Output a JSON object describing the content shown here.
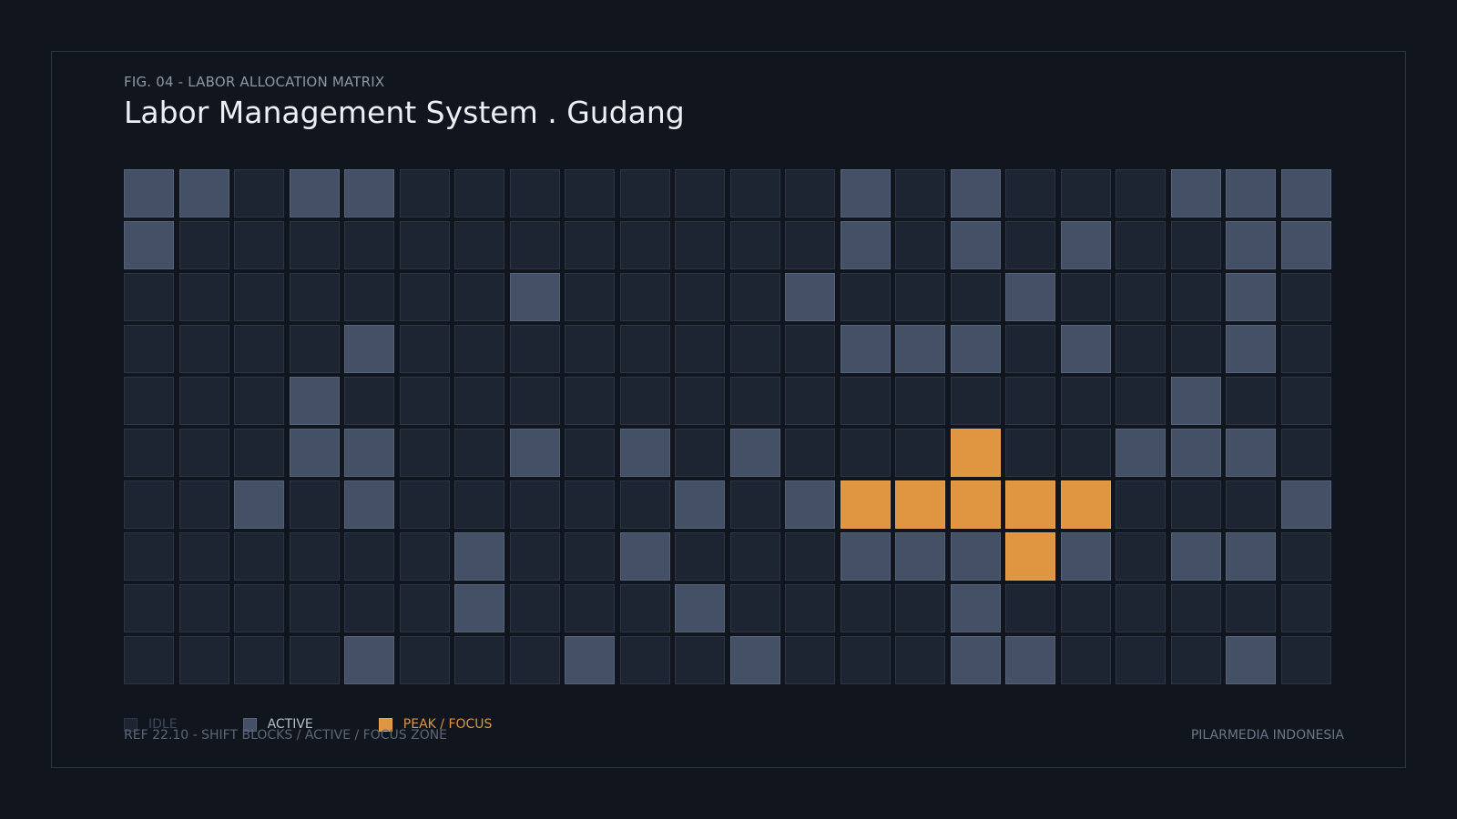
{
  "header": {
    "fig_label": "FIG. 04 - LABOR ALLOCATION MATRIX",
    "title": "Labor Management System . Gudang"
  },
  "legend": {
    "idle": "IDLE",
    "active": "ACTIVE",
    "peak": "PEAK / FOCUS"
  },
  "footer": {
    "ref": "REF 22.10 - SHIFT BLOCKS / ACTIVE / FOCUS ZONE",
    "brand": "PILARMEDIA INDONESIA"
  },
  "colors": {
    "background": "#10151e",
    "idle": "#1e2532",
    "active": "#435066",
    "peak": "#e09540"
  },
  "chart_data": {
    "type": "heatmap",
    "columns": 22,
    "rows": 10,
    "levels": [
      "idle",
      "active",
      "peak"
    ],
    "values": [
      [
        1,
        1,
        0,
        1,
        1,
        0,
        0,
        0,
        0,
        0,
        0,
        0,
        0,
        1,
        0,
        1,
        0,
        0,
        0,
        1,
        1,
        1
      ],
      [
        1,
        0,
        0,
        0,
        0,
        0,
        0,
        0,
        0,
        0,
        0,
        0,
        0,
        1,
        0,
        1,
        0,
        1,
        0,
        0,
        1,
        1
      ],
      [
        0,
        0,
        0,
        0,
        0,
        0,
        0,
        1,
        0,
        0,
        0,
        0,
        1,
        0,
        0,
        0,
        1,
        0,
        0,
        0,
        1,
        0
      ],
      [
        0,
        0,
        0,
        0,
        1,
        0,
        0,
        0,
        0,
        0,
        0,
        0,
        0,
        1,
        1,
        1,
        0,
        1,
        0,
        0,
        1,
        0
      ],
      [
        0,
        0,
        0,
        1,
        0,
        0,
        0,
        0,
        0,
        0,
        0,
        0,
        0,
        0,
        0,
        0,
        0,
        0,
        0,
        1,
        0,
        0
      ],
      [
        0,
        0,
        0,
        1,
        1,
        0,
        0,
        1,
        0,
        1,
        0,
        1,
        0,
        0,
        0,
        2,
        0,
        0,
        1,
        1,
        1,
        0
      ],
      [
        0,
        0,
        1,
        0,
        1,
        0,
        0,
        0,
        0,
        0,
        1,
        0,
        1,
        2,
        2,
        2,
        2,
        2,
        0,
        0,
        0,
        1
      ],
      [
        0,
        0,
        0,
        0,
        0,
        0,
        1,
        0,
        0,
        1,
        0,
        0,
        0,
        1,
        1,
        1,
        2,
        1,
        0,
        1,
        1,
        0
      ],
      [
        0,
        0,
        0,
        0,
        0,
        0,
        1,
        0,
        0,
        0,
        1,
        0,
        0,
        0,
        0,
        1,
        0,
        0,
        0,
        0,
        0,
        0
      ],
      [
        0,
        0,
        0,
        0,
        1,
        0,
        0,
        0,
        1,
        0,
        0,
        1,
        0,
        0,
        0,
        1,
        1,
        0,
        0,
        0,
        1,
        0
      ]
    ],
    "legend_placement": "bottom-left",
    "grid": false
  }
}
